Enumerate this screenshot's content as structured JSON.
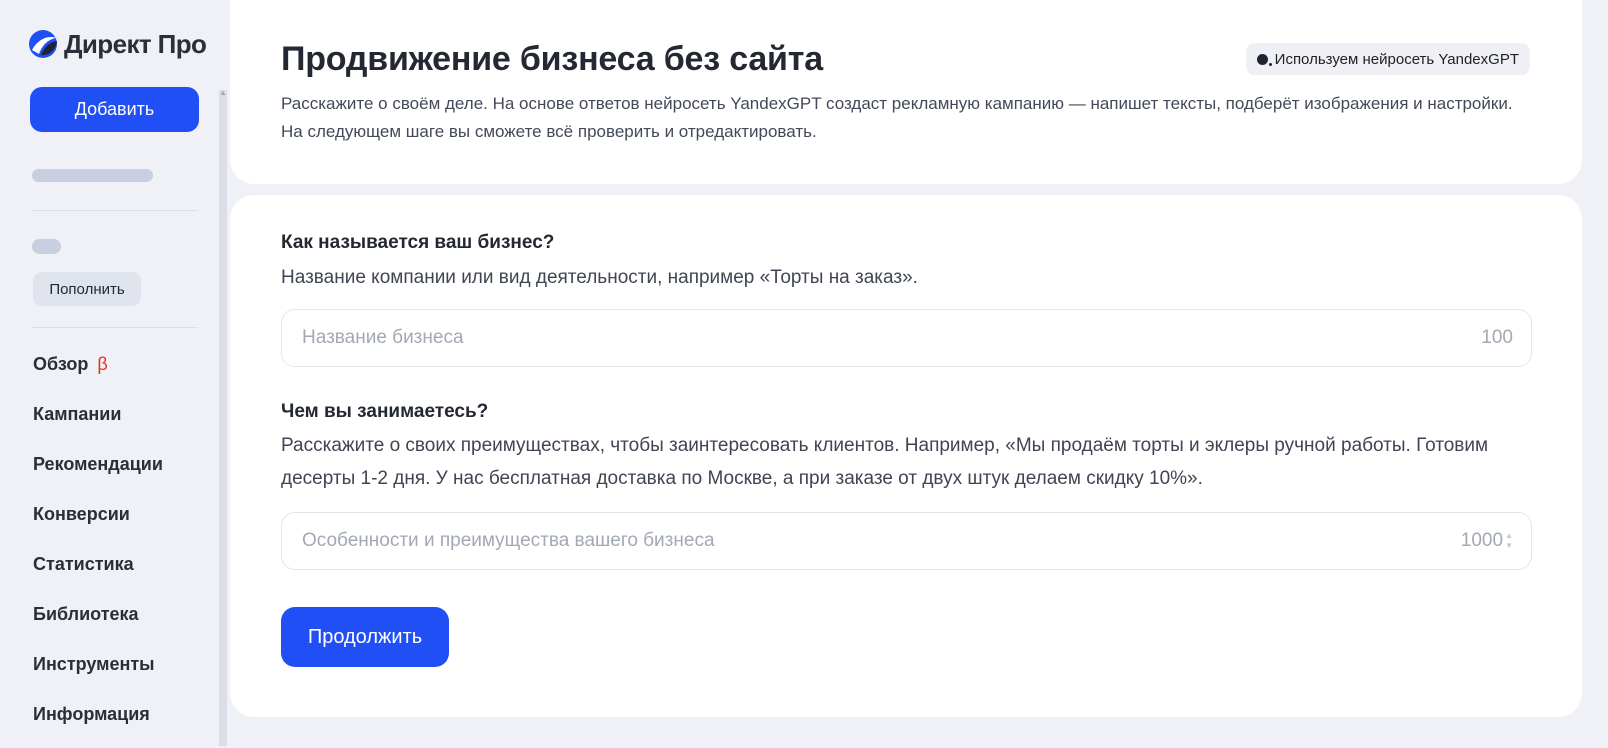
{
  "sidebar": {
    "logo_text": "Директ Про",
    "add_label": "Добавить",
    "topup_label": "Пополнить",
    "nav": [
      {
        "label": "Обзор",
        "badge": "β"
      },
      {
        "label": "Кампании"
      },
      {
        "label": "Рекомендации"
      },
      {
        "label": "Конверсии"
      },
      {
        "label": "Статистика"
      },
      {
        "label": "Библиотека"
      },
      {
        "label": "Инструменты"
      },
      {
        "label": "Информация"
      }
    ]
  },
  "header": {
    "title": "Продвижение бизнеса без сайта",
    "badge": "Используем нейросеть YandexGPT",
    "intro": "Расскажите о своём деле. На основе ответов нейросеть YandexGPT создаст рекламную кампанию — напишет тексты, подберёт изображения и настройки. На следующем шаге вы сможете всё проверить и отредактировать."
  },
  "form": {
    "q1": {
      "label": "Как называется ваш бизнес?",
      "hint": "Название компании или вид деятельности, например «Торты на заказ».",
      "placeholder": "Название бизнеса",
      "value": "",
      "counter": "100"
    },
    "q2": {
      "label": "Чем вы занимаетесь?",
      "hint": "Расскажите о своих преимуществах, чтобы заинтересовать клиентов. Например, «Мы продаём торты и эклеры ручной работы. Готовим десерты 1-2 дня. У нас бесплатная доставка по Москве, а при заказе от двух штук делаем скидку 10%».",
      "placeholder": "Особенности и преимущества вашего бизнеса",
      "value": "",
      "counter": "1000"
    },
    "continue_label": "Продолжить"
  },
  "colors": {
    "accent": "#1f4ff5",
    "background": "#eff1f6",
    "beta": "#e8311f"
  }
}
